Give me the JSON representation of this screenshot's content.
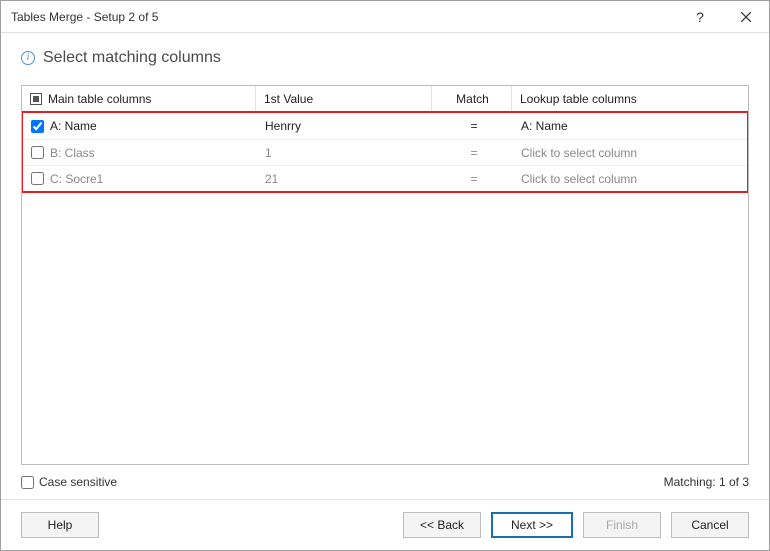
{
  "window": {
    "title": "Tables Merge - Setup 2 of 5"
  },
  "page": {
    "heading": "Select matching columns"
  },
  "grid": {
    "headers": {
      "main": "Main table columns",
      "first": "1st Value",
      "match": "Match",
      "lookup": "Lookup table columns"
    },
    "rows": [
      {
        "checked": true,
        "main": "A: Name",
        "first": "Henrry",
        "match": "=",
        "lookup": "A: Name"
      },
      {
        "checked": false,
        "main": "B: Class",
        "first": "1",
        "match": "=",
        "lookup": "Click to select column"
      },
      {
        "checked": false,
        "main": "C: Socre1",
        "first": "21",
        "match": "=",
        "lookup": "Click to select column"
      }
    ]
  },
  "options": {
    "case_sensitive_label": "Case sensitive"
  },
  "status": {
    "matching_label": "Matching: 1 of 3"
  },
  "buttons": {
    "help": "Help",
    "back": "<< Back",
    "next": "Next >>",
    "finish": "Finish",
    "cancel": "Cancel"
  }
}
